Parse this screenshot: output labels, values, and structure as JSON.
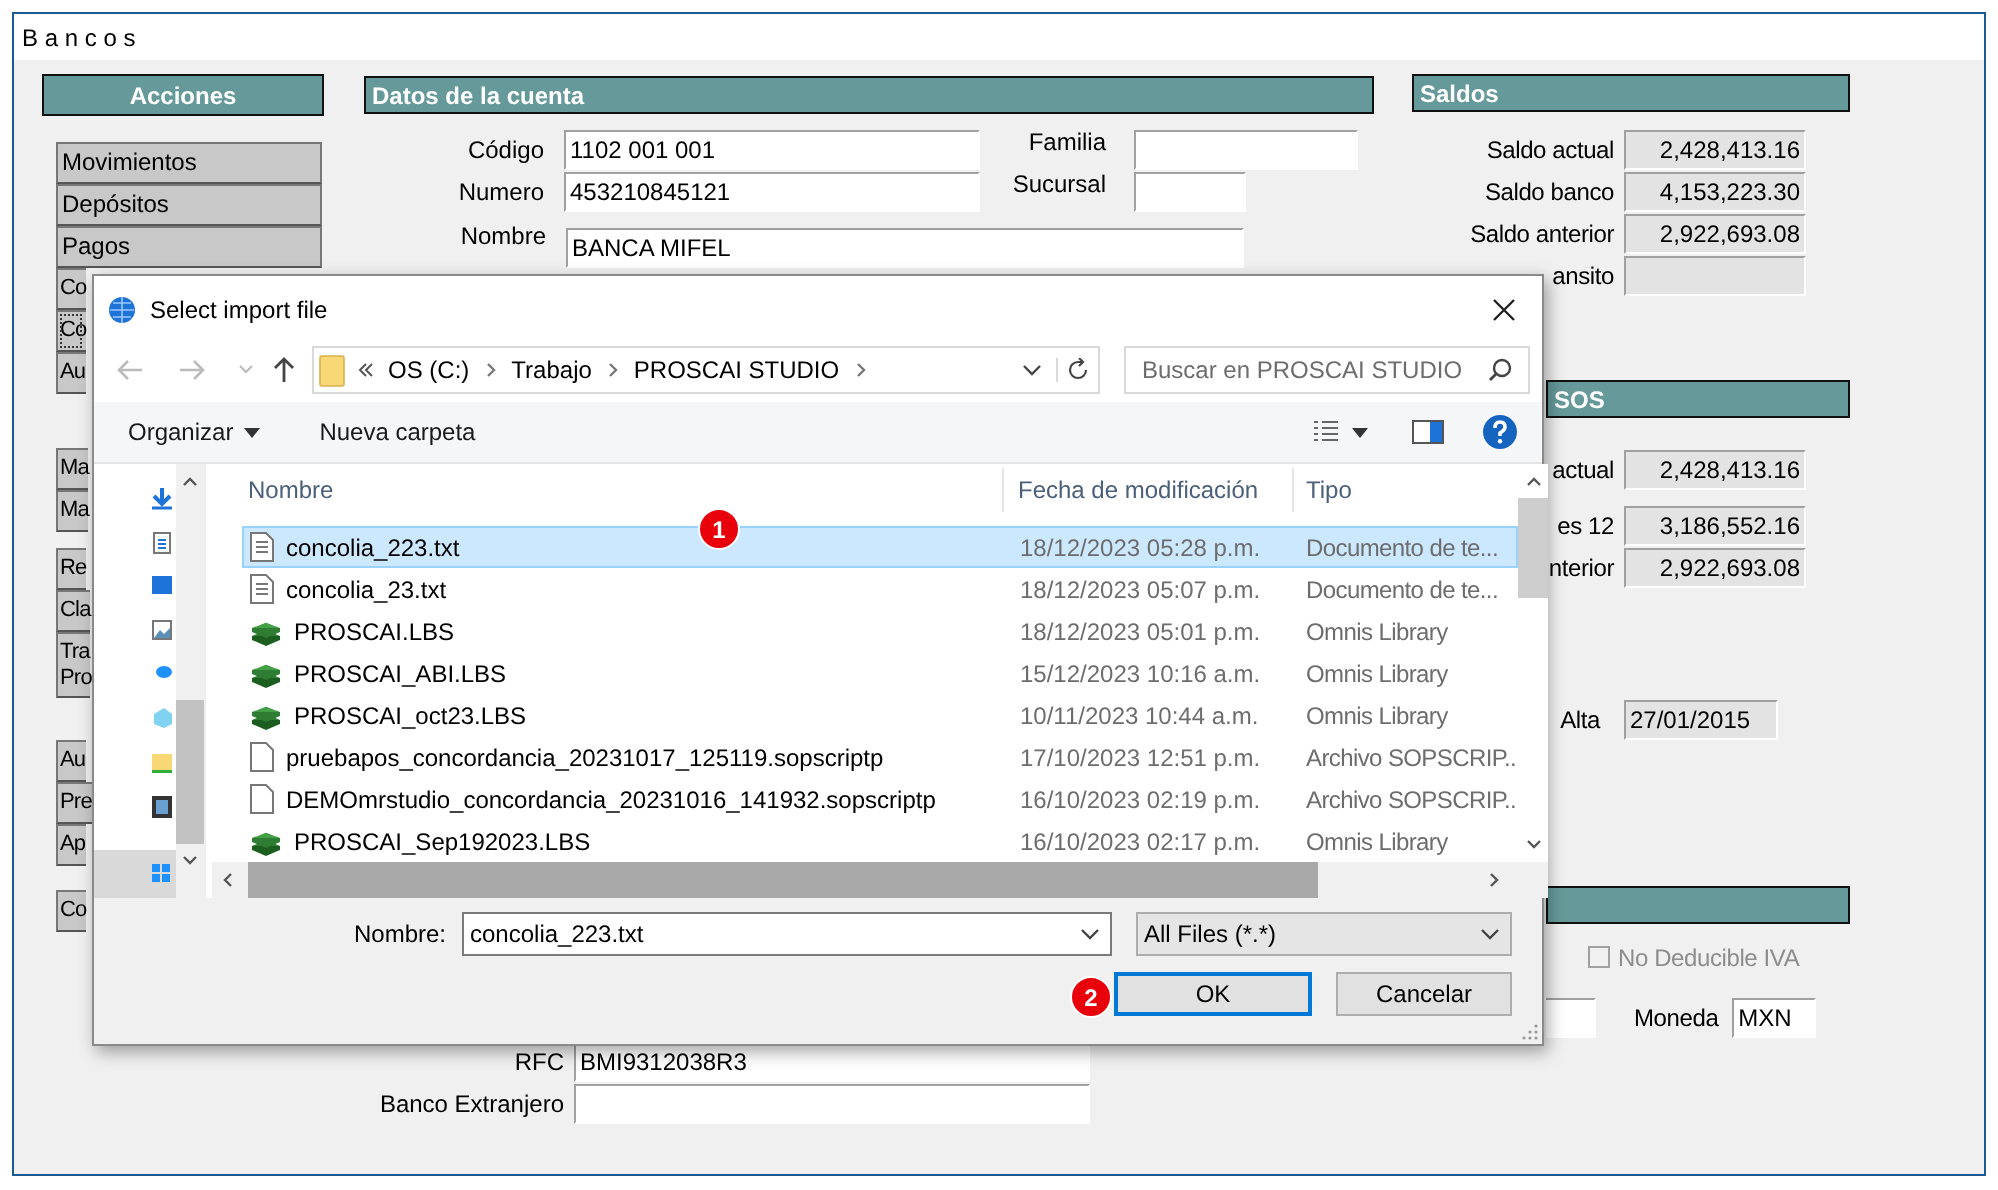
{
  "window": {
    "title": "B a n c o s"
  },
  "actions": {
    "title": "Acciones",
    "groups": [
      [
        {
          "label": "Movimientos",
          "focused": false
        },
        {
          "label": "Depósitos",
          "focused": false
        },
        {
          "label": "Pagos",
          "focused": false
        },
        {
          "label": "Co",
          "focused": false
        },
        {
          "label": "Co",
          "focused": true
        },
        {
          "label": "Au",
          "focused": false
        }
      ],
      [
        {
          "label": "Ma",
          "focused": false
        },
        {
          "label": "Ma",
          "focused": false
        }
      ],
      [
        {
          "label": "Re",
          "focused": false
        },
        {
          "label": "Cla",
          "focused": false
        },
        {
          "label": "Tra Pro",
          "focused": false
        }
      ],
      [
        {
          "label": "Au",
          "focused": false
        },
        {
          "label": "Pre",
          "focused": false
        },
        {
          "label": "Ap",
          "focused": false
        }
      ],
      [
        {
          "label": "Co",
          "focused": false
        }
      ]
    ]
  },
  "account": {
    "title": "Datos de la cuenta",
    "codigo": {
      "label": "Código",
      "value": "1102 001 001"
    },
    "familia": {
      "label": "Familia"
    },
    "numero": {
      "label": "Numero",
      "value": "453210845121"
    },
    "sucursal": {
      "label": "Sucursal"
    },
    "nombre": {
      "label": "Nombre",
      "value": "BANCA MIFEL"
    },
    "rfc": {
      "label": "RFC",
      "value": "BMI9312038R3"
    },
    "banco_extranjero": {
      "label": "Banco Extranjero"
    }
  },
  "balances": {
    "title": "Saldos",
    "fields": [
      {
        "label": "Saldo actual",
        "value": "2,428,413.16"
      },
      {
        "label": "Saldo banco",
        "value": "4,153,223.30"
      },
      {
        "label": "Saldo anterior",
        "value": "2,922,693.08"
      },
      {
        "label": "ansito"
      }
    ]
  },
  "section_2": {
    "title": "SOS",
    "fields": [
      {
        "label": "actual",
        "value": "2,428,413.16"
      },
      {
        "label": "es 12",
        "value": "3,186,552.16"
      },
      {
        "label": "nterior",
        "value": "2,922,693.08"
      }
    ],
    "alta": {
      "label": "Alta",
      "value": "27/01/2015"
    }
  },
  "section_3": {
    "no_deducible_iva": {
      "label": "No Deducible IVA",
      "checked": false,
      "disabled": true
    },
    "moneda": {
      "label": "Moneda",
      "value": "MXN"
    }
  },
  "dialog": {
    "title": "Select import file",
    "path": [
      "OS (C:)",
      "Trabajo",
      "PROSCAI STUDIO"
    ],
    "search": {
      "placeholder": "Buscar en PROSCAI STUDIO"
    },
    "toolbar": [
      "Organizar",
      "Nueva carpeta"
    ],
    "columns": [
      "Nombre",
      "Fecha de modificación",
      "Tipo"
    ],
    "files": [
      {
        "name": "concolia_223.txt",
        "date": "18/12/2023 05:28 p.m.",
        "type": "Documento de te...",
        "kind": "text",
        "selected": true
      },
      {
        "name": "concolia_23.txt",
        "date": "18/12/2023 05:07 p.m.",
        "type": "Documento de te...",
        "kind": "text",
        "selected": false
      },
      {
        "name": "PROSCAI.LBS",
        "date": "18/12/2023 05:01 p.m.",
        "type": "Omnis Library",
        "kind": "library",
        "selected": false
      },
      {
        "name": "PROSCAI_ABI.LBS",
        "date": "15/12/2023 10:16 a.m.",
        "type": "Omnis Library",
        "kind": "library",
        "selected": false
      },
      {
        "name": "PROSCAI_oct23.LBS",
        "date": "10/11/2023 10:44 a.m.",
        "type": "Omnis Library",
        "kind": "library",
        "selected": false
      },
      {
        "name": "pruebapos_concordancia_20231017_125119.sopscriptp",
        "date": "17/10/2023 12:51 p.m.",
        "type": "Archivo SOPSCRIP..",
        "kind": "script",
        "selected": false
      },
      {
        "name": "DEMOmrstudio_concordancia_20231016_141932.sopscriptp",
        "date": "16/10/2023 02:19 p.m.",
        "type": "Archivo SOPSCRIP..",
        "kind": "script",
        "selected": false
      },
      {
        "name": "PROSCAI_Sep192023.LBS",
        "date": "16/10/2023 02:17 p.m.",
        "type": "Omnis Library",
        "kind": "library",
        "selected": false
      }
    ],
    "file_name": {
      "label": "Nombre:",
      "value": "concolia_223.txt"
    },
    "filter": "All Files (*.*)",
    "buttons": [
      {
        "label": "OK",
        "default": true
      },
      {
        "label": "Cancelar",
        "default": false
      }
    ],
    "callouts": [
      "1",
      "2"
    ]
  }
}
